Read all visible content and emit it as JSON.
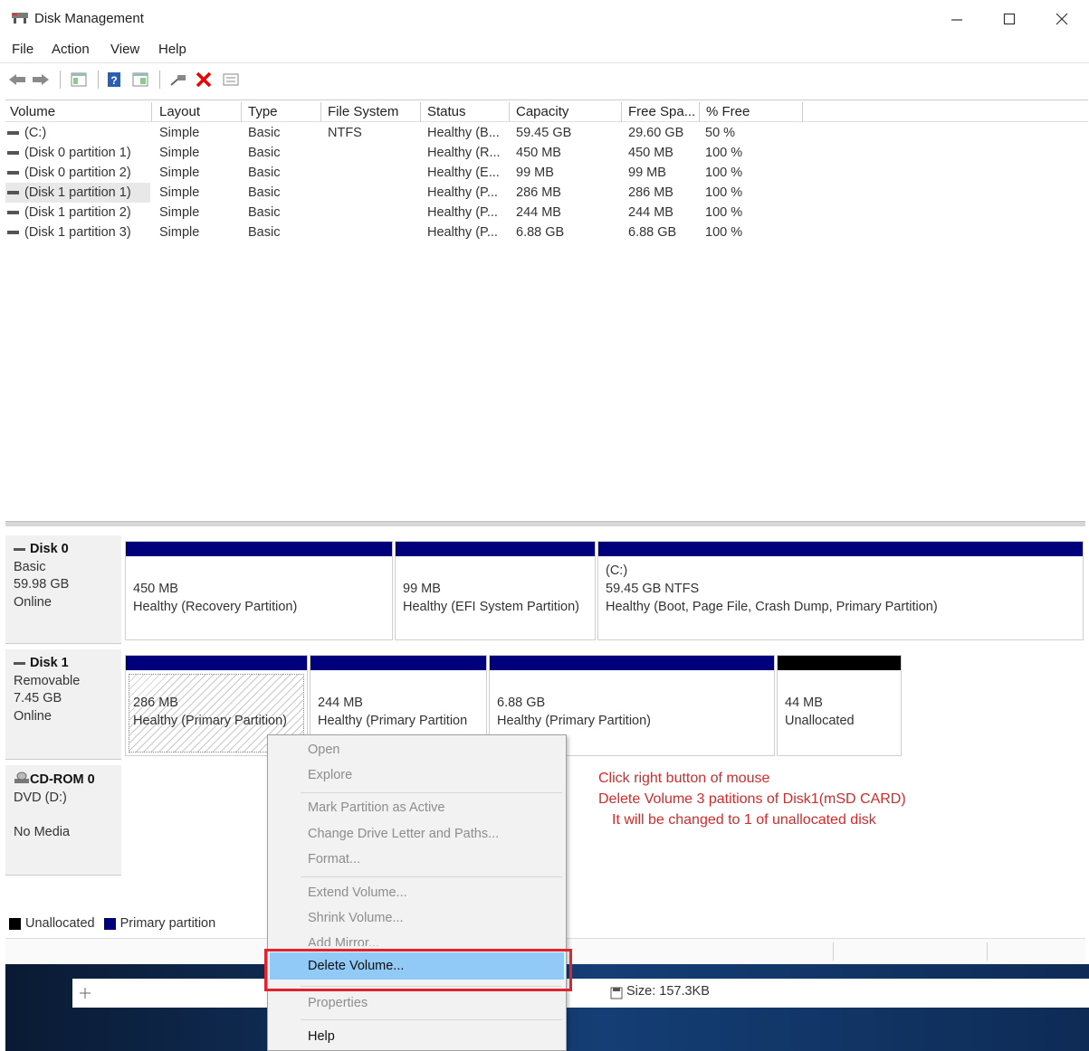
{
  "window": {
    "title": "Disk Management",
    "icon": "disk-management-icon",
    "controls": [
      "minimize",
      "maximize",
      "close"
    ]
  },
  "menu": [
    "File",
    "Action",
    "View",
    "Help"
  ],
  "toolbar": {
    "icons": [
      "back-icon",
      "forward-icon",
      "console-tree-icon",
      "help-icon",
      "properties-icon",
      "connect-icon",
      "delete-icon",
      "list-icon"
    ]
  },
  "list": {
    "columns": [
      "Volume",
      "Layout",
      "Type",
      "File System",
      "Status",
      "Capacity",
      "Free Spa...",
      "% Free"
    ],
    "rows": [
      [
        "(C:)",
        "Simple",
        "Basic",
        "NTFS",
        "Healthy (B...",
        "59.45 GB",
        "29.60 GB",
        "50 %"
      ],
      [
        "(Disk 0 partition 1)",
        "Simple",
        "Basic",
        "",
        "Healthy (R...",
        "450 MB",
        "450 MB",
        "100 %"
      ],
      [
        "(Disk 0 partition 2)",
        "Simple",
        "Basic",
        "",
        "Healthy (E...",
        "99 MB",
        "99 MB",
        "100 %"
      ],
      [
        "(Disk 1 partition 1)",
        "Simple",
        "Basic",
        "",
        "Healthy (P...",
        "286 MB",
        "286 MB",
        "100 %"
      ],
      [
        "(Disk 1 partition 2)",
        "Simple",
        "Basic",
        "",
        "Healthy (P...",
        "244 MB",
        "244 MB",
        "100 %"
      ],
      [
        "(Disk 1 partition 3)",
        "Simple",
        "Basic",
        "",
        "Healthy (P...",
        "6.88 GB",
        "6.88 GB",
        "100 %"
      ]
    ]
  },
  "disks": {
    "disk0": {
      "name": "Disk 0",
      "type": "Basic",
      "size": "59.98 GB",
      "state": "Online",
      "partitions": [
        {
          "line1": "450 MB",
          "line2": "Healthy (Recovery Partition)"
        },
        {
          "line1": "99 MB",
          "line2": "Healthy (EFI System Partition)"
        },
        {
          "line0": "(C:)",
          "line1": "59.45 GB NTFS",
          "line2": "Healthy (Boot, Page File, Crash Dump, Primary Partition)"
        }
      ]
    },
    "disk1": {
      "name": "Disk 1",
      "type": "Removable",
      "size": "7.45 GB",
      "state": "Online",
      "partitions": [
        {
          "line1": "286 MB",
          "line2": "Healthy (Primary Partition)"
        },
        {
          "line1": "244 MB",
          "line2": "Healthy (Primary Partition"
        },
        {
          "line1": "6.88 GB",
          "line2": "Healthy (Primary Partition)"
        },
        {
          "line1": "44 MB",
          "line2": "Unallocated"
        }
      ]
    },
    "cdrom": {
      "name": "CD-ROM 0",
      "type": "DVD (D:)",
      "state": "No Media"
    }
  },
  "legend": {
    "unallocated": "Unallocated",
    "primary": "Primary partition",
    "colors": {
      "unallocated": "#000000",
      "primary": "#00007c"
    }
  },
  "annotation": {
    "line1": "Click right button of mouse",
    "line2": "Delete Volume 3 patitions of Disk1(mSD CARD)",
    "line3": "It will be changed to 1 of unallocated disk",
    "color": "#d62a2a"
  },
  "context_menu": {
    "open": "Open",
    "explore": "Explore",
    "mark_active": "Mark Partition as Active",
    "change_letter": "Change Drive Letter and Paths...",
    "format": "Format...",
    "extend": "Extend Volume...",
    "shrink": "Shrink Volume...",
    "add_mirror": "Add Mirror...",
    "delete": "Delete Volume...",
    "properties": "Properties",
    "help": "Help"
  },
  "background_window": {
    "size": "Size: 157.3KB"
  }
}
